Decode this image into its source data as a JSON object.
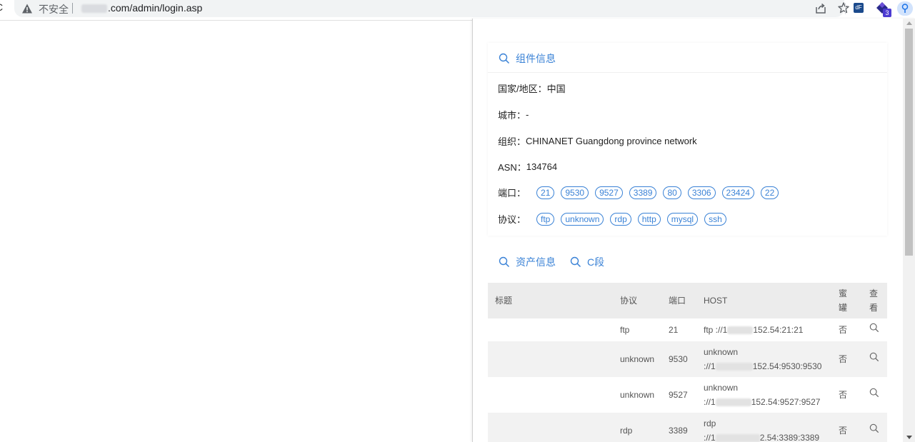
{
  "browser": {
    "insecure_label": "不安全",
    "url_suffix": ".com/admin/login.asp",
    "ext_badge": "3"
  },
  "component_card": {
    "title": "组件信息",
    "country_label": "国家/地区：",
    "country_value": "中国",
    "city_label": "城市：",
    "city_value": "-",
    "org_label": "组织：",
    "org_value": "CHINANET Guangdong province network",
    "asn_label": "ASN：",
    "asn_value": "134764",
    "ports_label": "端口：",
    "ports": [
      "21",
      "9530",
      "9527",
      "3389",
      "80",
      "3306",
      "23424",
      "22"
    ],
    "protocols_label": "协议：",
    "protocols": [
      "ftp",
      "unknown",
      "rdp",
      "http",
      "mysql",
      "ssh"
    ]
  },
  "asset_card": {
    "tab_assets": "资产信息",
    "tab_csegment": "C段",
    "columns": {
      "title": "标题",
      "protocol": "协议",
      "port": "端口",
      "host": "HOST",
      "honeypot_1": "蜜",
      "honeypot_2": "罐",
      "view_1": "查",
      "view_2": "看"
    },
    "rows": [
      {
        "title": "",
        "protocol": "ftp",
        "port": "21",
        "host_1": "ftp ://1",
        "host_2": "152.54:21:21",
        "honeypot": "否"
      },
      {
        "title": "",
        "protocol": "unknown",
        "port": "9530",
        "host_1": "unknown",
        "host_2a": "://1",
        "host_2b": "152.54:9530:9530",
        "honeypot": "否"
      },
      {
        "title": "",
        "protocol": "unknown",
        "port": "9527",
        "host_1": "unknown",
        "host_2a": "://1",
        "host_2b": "152.54:9527:9527",
        "honeypot": "否"
      },
      {
        "title": "",
        "protocol": "rdp",
        "port": "3389",
        "host_1": "rdp",
        "host_2a": "://1",
        "host_2b": "2.54:3389:3389",
        "honeypot": "否"
      }
    ]
  },
  "colors": {
    "accent": "#3a82d6",
    "header_bg": "#ececec",
    "row_alt_bg": "#f2f2f2"
  }
}
